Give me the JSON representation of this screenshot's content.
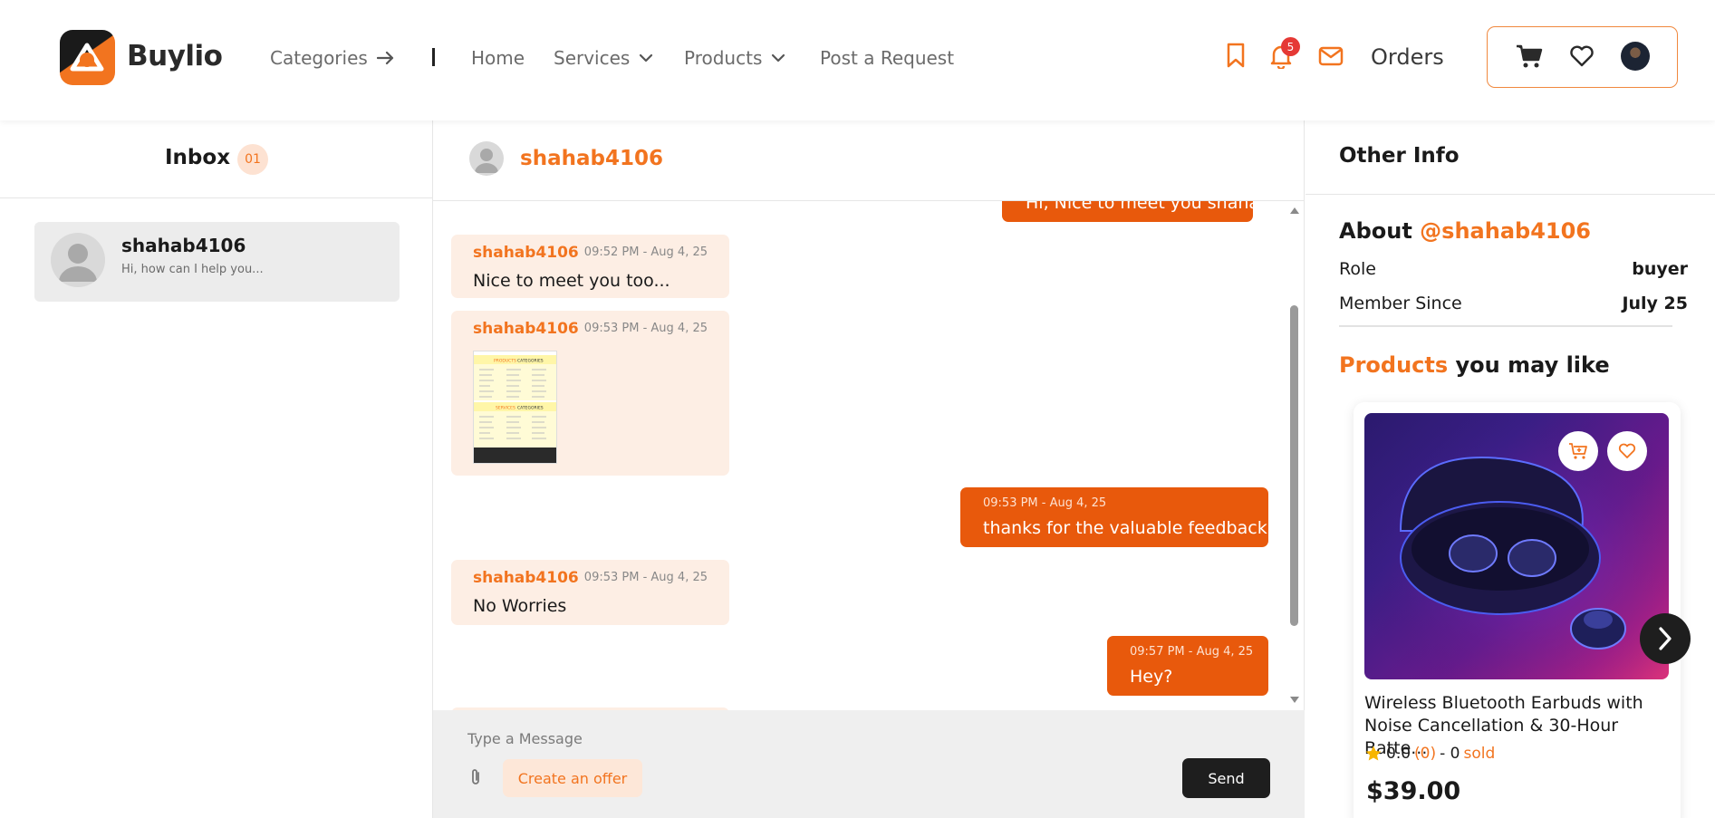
{
  "header": {
    "brand": "Buylio",
    "nav": {
      "categories": "Categories",
      "separator": "|",
      "home": "Home",
      "services": "Services",
      "products": "Products",
      "post_request": "Post a Request"
    },
    "notification_count": "5",
    "orders": "Orders"
  },
  "inbox": {
    "title": "Inbox",
    "count": "01",
    "conversations": [
      {
        "name": "shahab4106",
        "preview": "Hi, how can I help you..."
      }
    ]
  },
  "chat": {
    "contact": "shahab4106",
    "messages": [
      {
        "direction": "out",
        "time": "",
        "text": "Hi, Nice to meet you shahab"
      },
      {
        "direction": "in",
        "sender": "shahab4106",
        "time": "09:52 PM - Aug 4, 25",
        "text": "Nice to meet you too..."
      },
      {
        "direction": "in",
        "sender": "shahab4106",
        "time": "09:53 PM - Aug 4, 25",
        "text": "",
        "attachment": "image"
      },
      {
        "direction": "out",
        "time": "09:53 PM - Aug 4, 25",
        "text": "thanks for the valuable feedback"
      },
      {
        "direction": "in",
        "sender": "shahab4106",
        "time": "09:53 PM - Aug 4, 25",
        "text": "No Worries"
      },
      {
        "direction": "out",
        "time": "09:57 PM - Aug 4, 25",
        "text": "Hey?"
      }
    ],
    "thumbnail_labels": {
      "products": "PRODUCTS",
      "categories": "CATEGORIES",
      "services": "SERVICES"
    },
    "composer": {
      "placeholder": "Type a Message",
      "offer_label": "Create an offer",
      "send_label": "Send"
    }
  },
  "other_info": {
    "title": "Other Info",
    "about_prefix": "About",
    "about_handle": "@shahab4106",
    "role_label": "Role",
    "role_value": "buyer",
    "member_label": "Member Since",
    "member_value": "July 25",
    "products_word": "Products",
    "products_rest": " you may like",
    "product": {
      "title": "Wireless Bluetooth Earbuds with Noise Cancellation & 30-Hour Batte...",
      "rating": "0.0",
      "reviews": "(0)",
      "sold_count": "- 0",
      "sold_label": "sold",
      "price": "$39.00"
    }
  },
  "colors": {
    "accent": "#f2741f",
    "outgoing_bubble": "#e8590c",
    "incoming_bubble": "#fdeee4",
    "dark": "#1e1e1e"
  },
  "icons": [
    "arrow-right-icon",
    "chevron-down-icon",
    "bookmark-icon",
    "bell-icon",
    "mail-icon",
    "cart-icon",
    "heart-icon",
    "user-icon",
    "paperclip-icon",
    "add-to-cart-icon",
    "star-icon",
    "chevron-right-icon"
  ]
}
